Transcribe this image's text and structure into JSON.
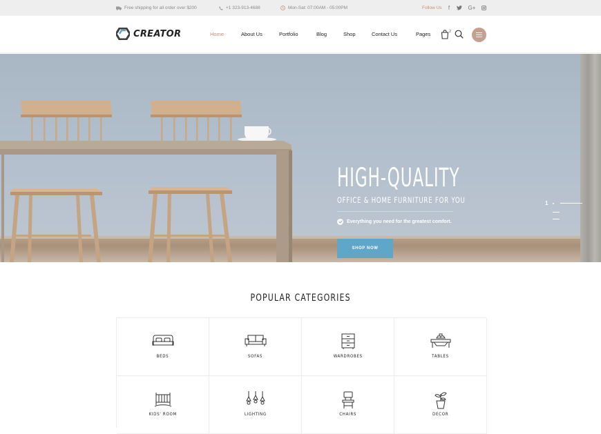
{
  "topbar": {
    "shipping": "Free shipping for all order over $200",
    "phone": "+1 323-913-4688",
    "hours": "Mon-Sat: 07:00AM - 05:00PM",
    "follow_label": "Follow Us",
    "social": [
      {
        "icon": "facebook-icon",
        "glyph": "f"
      },
      {
        "icon": "twitter-icon",
        "glyph": "t"
      },
      {
        "icon": "google-plus-icon",
        "glyph": "G+"
      },
      {
        "icon": "instagram-icon",
        "glyph": ""
      }
    ]
  },
  "header": {
    "logo": "CREATOR",
    "nav": [
      "Home",
      "About Us",
      "Portfolio",
      "Blog",
      "Shop",
      "Contact Us",
      "Pages"
    ],
    "active_nav": "Home",
    "cart_count": "2",
    "accent_color": "#c3907a"
  },
  "hero": {
    "title": "HIGH-QUALITY",
    "subtitle": "OFFICE & HOME FURNITURE FOR YOU",
    "tagline": "Everything you need for the greatest comfort.",
    "cta": "SHOP NOW",
    "cta_color": "#5fa6c8",
    "current_slide": "1"
  },
  "categories": {
    "title": "POPULAR CATEGORIES",
    "items": [
      {
        "label": "BEDS",
        "icon": "bed-icon"
      },
      {
        "label": "SOFAS",
        "icon": "sofa-icon"
      },
      {
        "label": "WARDROBES",
        "icon": "wardrobe-icon"
      },
      {
        "label": "TABLES",
        "icon": "table-icon"
      },
      {
        "label": "KIDS' ROOM",
        "icon": "crib-icon"
      },
      {
        "label": "LIGHTING",
        "icon": "lamp-icon"
      },
      {
        "label": "CHAIRS",
        "icon": "chair-icon"
      },
      {
        "label": "DECOR",
        "icon": "plant-icon"
      }
    ]
  }
}
